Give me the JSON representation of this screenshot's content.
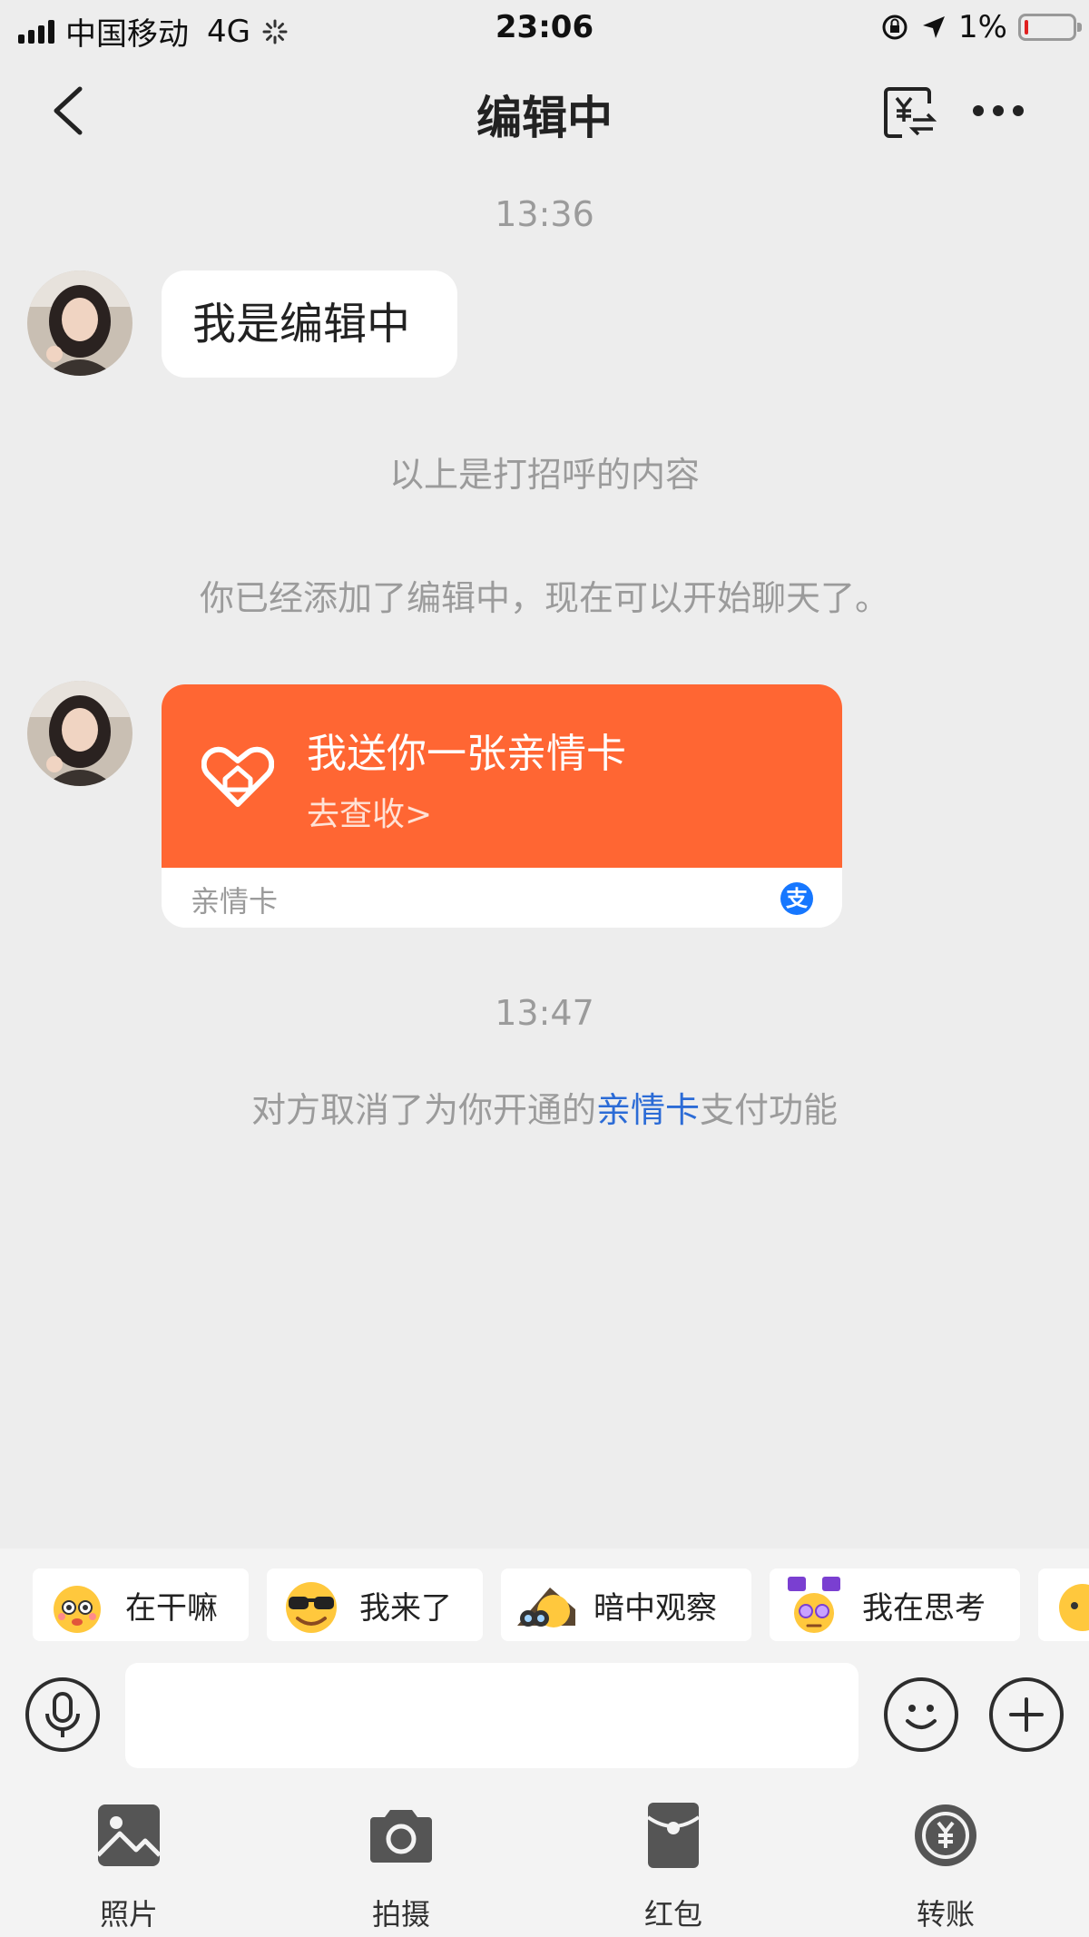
{
  "status_bar": {
    "carrier": "中国移动",
    "network": "4G",
    "time": "23:06",
    "battery": "1%"
  },
  "nav": {
    "title": "编辑中"
  },
  "messages": {
    "timestamp1": "13:36",
    "greeting_bubble": "我是编辑中",
    "system_greeting_note": "以上是打招呼的内容",
    "system_added_note": "你已经添加了编辑中，现在可以开始聊天了。",
    "card": {
      "title": "我送你一张亲情卡",
      "subtitle": "去查收>",
      "footer": "亲情卡",
      "badge": "支"
    },
    "timestamp2": "13:47",
    "cancel_note": {
      "before": "对方取消了为你开通的",
      "link": "亲情卡",
      "after": "支付功能"
    }
  },
  "stickers": [
    {
      "label": "在干嘛"
    },
    {
      "label": "我来了"
    },
    {
      "label": "暗中观察"
    },
    {
      "label": "我在思考"
    }
  ],
  "tools": [
    {
      "label": "照片",
      "icon": "photo-icon"
    },
    {
      "label": "拍摄",
      "icon": "camera-icon"
    },
    {
      "label": "红包",
      "icon": "red-envelope-icon"
    },
    {
      "label": "转账",
      "icon": "transfer-icon"
    }
  ],
  "colors": {
    "accent_orange": "#ff6633",
    "link_blue": "#2b6bd6",
    "background": "#ededed"
  }
}
